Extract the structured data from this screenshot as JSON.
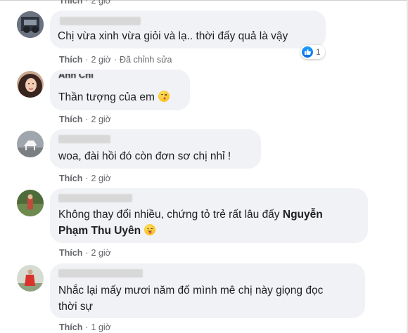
{
  "top_partial": {
    "action_like": "Thích",
    "time": "2 giờ"
  },
  "comments": [
    {
      "text": "Chị vừa xinh vừa giỏi và lạ.. thời đấy quả là vậy",
      "like_label": "Thích",
      "time": "2 giờ",
      "edited": "Đã chỉnh sửa",
      "reaction_icon": "like-reaction-icon",
      "reaction_count": "1"
    },
    {
      "name_partial": "Anh Chi",
      "text": "Thần tượng của em",
      "like_label": "Thích",
      "time": "2 giờ"
    },
    {
      "text": "woa, đài hồi đó còn đơn sơ chị nhỉ !",
      "like_label": "Thích",
      "time": "2 giờ"
    },
    {
      "text_line1": "Không thay đổi nhiều, chứng tỏ trẻ rất lâu đấy",
      "mention_part1": "Nguyễn",
      "mention_part2": "Phạm Thu Uyên",
      "like_label": "Thích",
      "time": "2 giờ"
    },
    {
      "text_line1": "Nhắc lại mấy mươi năm đố mình mê chị này giọng đọc",
      "text_line2": "thời sự",
      "like_label": "Thích",
      "time": "1 giờ"
    }
  ],
  "colors": {
    "bubble": "#f0f2f5",
    "meta": "#65676b",
    "like_blue": "#1877f2"
  }
}
